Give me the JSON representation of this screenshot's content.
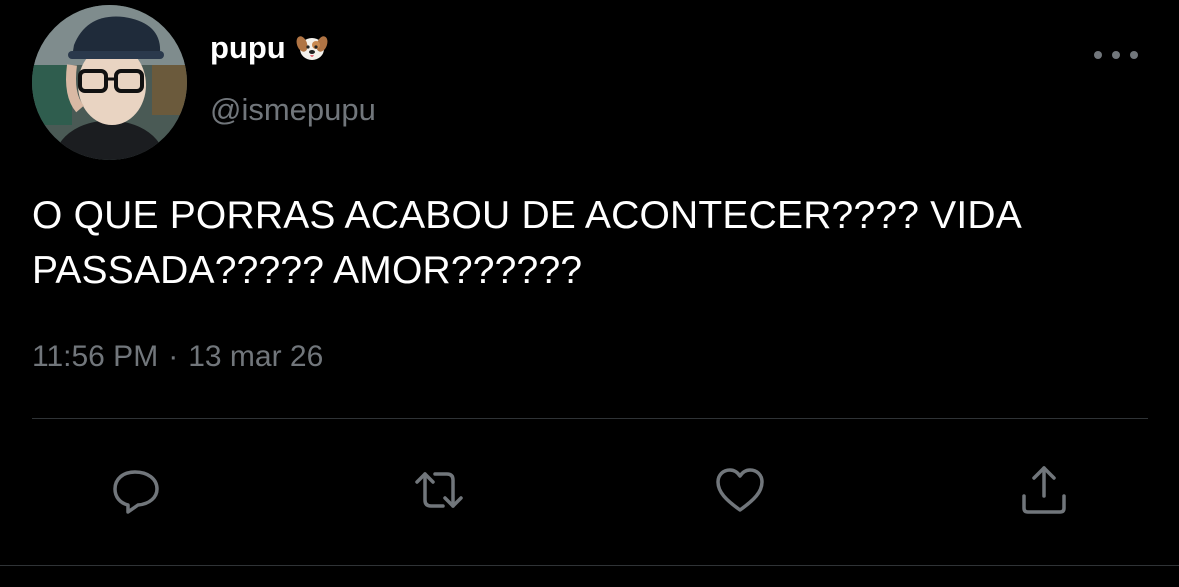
{
  "tweet": {
    "author": {
      "display_name": "pupu",
      "emoji_icon": "dog-face-emoji",
      "handle": "@ismepupu",
      "avatar_icon": "profile-photo"
    },
    "text": "O QUE PORRAS ACABOU DE ACONTECER???? VIDA PASSADA????? AMOR??????",
    "time": "11:56 PM",
    "separator": "·",
    "date": "13 mar 26"
  },
  "actions": [
    {
      "name": "reply",
      "icon": "reply-icon"
    },
    {
      "name": "retweet",
      "icon": "retweet-icon"
    },
    {
      "name": "like",
      "icon": "heart-icon"
    },
    {
      "name": "share",
      "icon": "share-icon"
    }
  ],
  "colors": {
    "background": "#000000",
    "text_primary": "#ffffff",
    "text_secondary": "#71767b",
    "divider": "#2f3336"
  }
}
